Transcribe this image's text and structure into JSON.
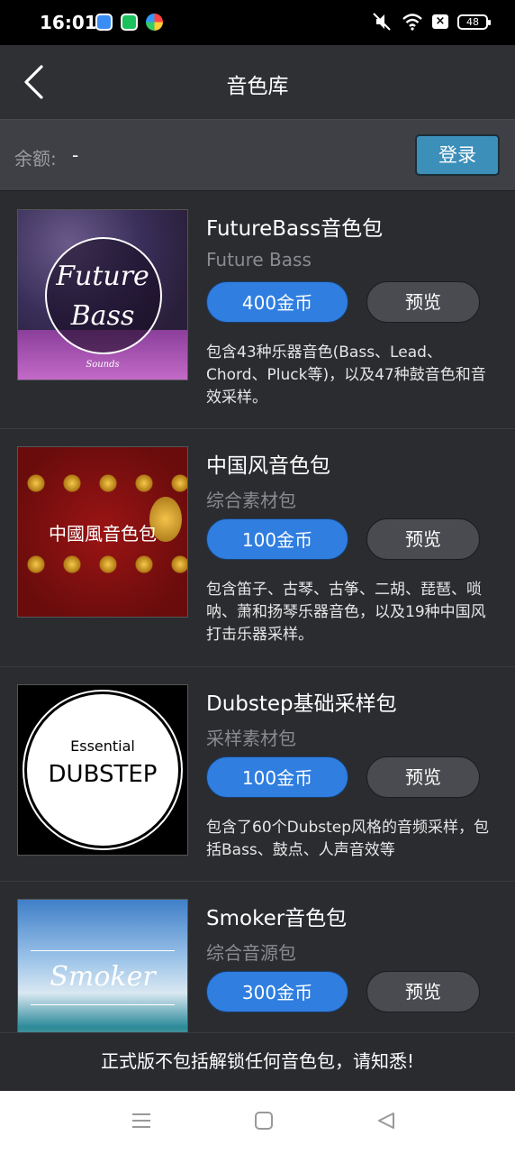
{
  "status_bar": {
    "time": "16:01",
    "battery": "48",
    "notification_box": "×"
  },
  "header": {
    "title": "音色库"
  },
  "account": {
    "balance_label": "余额:",
    "balance_value": "-",
    "login_label": "登录"
  },
  "packs": [
    {
      "name": "FutureBass音色包",
      "category": "Future Bass",
      "price": "400金币",
      "preview_label": "预览",
      "description": "包含43种乐器音色(Bass、Lead、Chord、Pluck等)，以及47种鼓音色和音效采样。",
      "art_line1": "Future",
      "art_line2": "Bass",
      "art_line3": "Sounds"
    },
    {
      "name": "中国风音色包",
      "category": "综合素材包",
      "price": "100金币",
      "preview_label": "预览",
      "description": "包含笛子、古琴、古筝、二胡、琵琶、唢呐、萧和扬琴乐器音色，以及19种中国风打击乐器采样。",
      "art_text": "中國風音色包"
    },
    {
      "name": "Dubstep基础采样包",
      "category": "采样素材包",
      "price": "100金币",
      "preview_label": "预览",
      "description": "包含了60个Dubstep风格的音频采样，包括Bass、鼓点、人声音效等",
      "art_line1": "Essential",
      "art_line2": "DUBSTEP"
    },
    {
      "name": "Smoker音色包",
      "category": "综合音源包",
      "price": "300金币",
      "preview_label": "预览",
      "art_text": "Smoker"
    }
  ],
  "footer": {
    "notice": "正式版不包括解锁任何音色包，请知悉!"
  },
  "system_nav": {
    "menu_icon": "menu-icon",
    "home_icon": "home-icon",
    "back_icon": "back-triangle-icon"
  }
}
